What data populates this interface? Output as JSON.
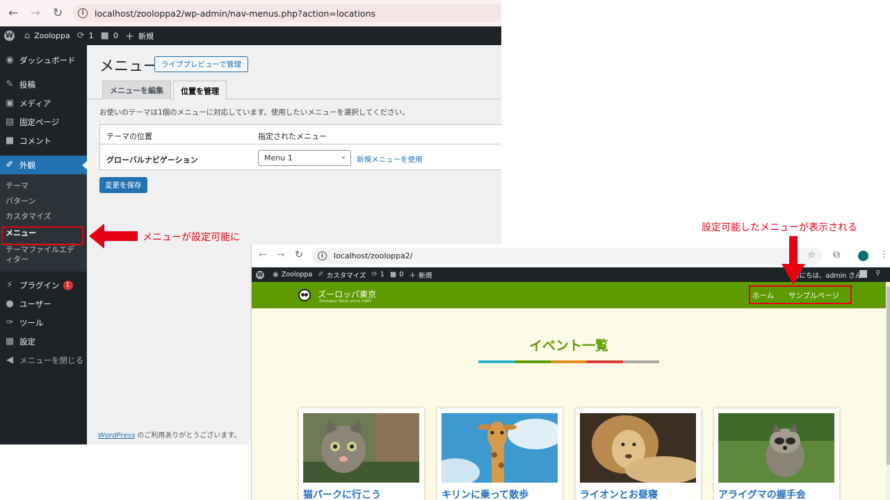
{
  "admin_screen": {
    "url": "localhost/zooloppa2/wp-admin/nav-menus.php?action=locations",
    "adminbar": {
      "site": "Zooloppa",
      "updates": "1",
      "comments": "0",
      "new": "新規"
    },
    "sidebar": {
      "items": [
        "ダッシュボード",
        "投稿",
        "メディア",
        "固定ページ",
        "コメント",
        "外観"
      ],
      "appearance_sub": [
        "テーマ",
        "パターン",
        "カスタマイズ",
        "メニュー",
        "テーマファイルエディター"
      ],
      "items2": [
        "プラグイン",
        "ユーザー",
        "ツール",
        "設定",
        "メニューを閉じる"
      ],
      "plugin_badge": "1"
    },
    "title": "メニュー",
    "live_preview_button": "ライブプレビューで管理",
    "tabs": [
      "メニューを編集",
      "位置を管理"
    ],
    "description": "お使いのテーマは1個のメニューに対応しています。使用したいメニューを選択してください。",
    "table": {
      "col_location": "テーマの位置",
      "col_menu": "指定されたメニュー",
      "row_location": "グローバルナビゲーション",
      "row_selected": "Menu 1",
      "row_link": "新規メニューを使用"
    },
    "save_button": "変更を保存",
    "footer_link": "WordPress",
    "footer_text": " のご利用ありがとうございます。"
  },
  "annotations": {
    "left_note": "メニューが設定可能に",
    "right_note": "設定可能したメニューが表示される"
  },
  "site_screen": {
    "url": "localhost/zooloppa2/",
    "adminbar": {
      "site": "Zooloppa",
      "customize": "カスタマイズ",
      "updates": "1",
      "comments": "0",
      "new": "新規",
      "greeting": "んにちは、admin さん"
    },
    "site_title": "ズーロッパ東京",
    "site_subtitle": "Zooloppa Tokyo since 1989",
    "nav": [
      "ホーム",
      "サンプルページ"
    ],
    "section_title": "イベント一覧",
    "rainbow_colors": [
      "#2bb5c9",
      "#5e9b00",
      "#e08a1e",
      "#d73b3b",
      "#a8a8a8"
    ],
    "cards": [
      {
        "title": "猫パークに行こう",
        "image": "kitten"
      },
      {
        "title": "キリンに乗って散歩",
        "image": "giraffe"
      },
      {
        "title": "ライオンとお昼寝",
        "image": "lion"
      },
      {
        "title": "アライグマの握手会",
        "image": "raccoon"
      }
    ]
  }
}
